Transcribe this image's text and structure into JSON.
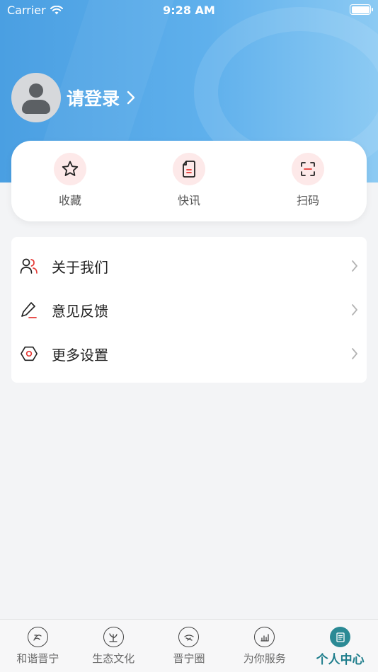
{
  "status_bar": {
    "carrier": "Carrier",
    "time": "9:28 AM"
  },
  "profile": {
    "login_label": "请登录"
  },
  "quick_actions": [
    {
      "label": "收藏",
      "icon": "star-icon"
    },
    {
      "label": "快讯",
      "icon": "document-icon"
    },
    {
      "label": "扫码",
      "icon": "scan-icon"
    }
  ],
  "menu": [
    {
      "label": "关于我们",
      "icon": "users-icon"
    },
    {
      "label": "意见反馈",
      "icon": "pen-icon"
    },
    {
      "label": "更多设置",
      "icon": "settings-hexagon-icon"
    }
  ],
  "tab_bar": {
    "items": [
      {
        "label": "和谐晋宁",
        "icon": "harmony-icon"
      },
      {
        "label": "生态文化",
        "icon": "ecology-icon"
      },
      {
        "label": "晋宁圈",
        "icon": "circle-community-icon"
      },
      {
        "label": "为你服务",
        "icon": "service-icon"
      },
      {
        "label": "个人中心",
        "icon": "profile-center-icon"
      }
    ],
    "active_index": 4
  },
  "colors": {
    "header_start": "#4a9fe2",
    "header_end": "#8ccaf3",
    "accent_red": "#e53935",
    "active_tab": "#1f7e8c",
    "quick_icon_bg": "#fde9e9"
  }
}
